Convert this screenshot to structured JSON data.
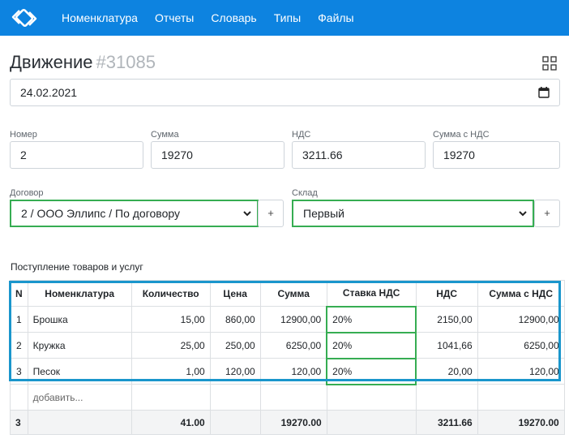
{
  "nav": {
    "items": [
      {
        "label": "Номенклатура"
      },
      {
        "label": "Отчеты"
      },
      {
        "label": "Словарь"
      },
      {
        "label": "Типы"
      },
      {
        "label": "Файлы"
      }
    ]
  },
  "page": {
    "title": "Движение",
    "doc_number": "#31085"
  },
  "date": {
    "value": "24.02.2021"
  },
  "fields": {
    "number": {
      "label": "Номер",
      "value": "2"
    },
    "sum": {
      "label": "Сумма",
      "value": "19270"
    },
    "vat": {
      "label": "НДС",
      "value": "3211.66"
    },
    "sum_vat": {
      "label": "Сумма с НДС",
      "value": "19270"
    }
  },
  "contract": {
    "label": "Договор",
    "value": "2 / ООО Эллипс / По договору",
    "add_label": "+"
  },
  "warehouse": {
    "label": "Склад",
    "value": "Первый",
    "add_label": "+"
  },
  "goods": {
    "title": "Поступление товаров и услуг",
    "headers": [
      "N",
      "Номенклатура",
      "Количество",
      "Цена",
      "Сумма",
      "Ставка НДС",
      "НДС",
      "Сумма с НДС"
    ],
    "rows": [
      [
        "1",
        "Брошка",
        "15,00",
        "860,00",
        "12900,00",
        "20%",
        "2150,00",
        "12900,00"
      ],
      [
        "2",
        "Кружка",
        "25,00",
        "250,00",
        "6250,00",
        "20%",
        "1041,66",
        "6250,00"
      ],
      [
        "3",
        "Песок",
        "1,00",
        "120,00",
        "120,00",
        "20%",
        "20,00",
        "120,00"
      ]
    ],
    "add_label": "добавить...",
    "footer": {
      "count": "3",
      "qty": "41.00",
      "sum": "19270.00",
      "vat": "3211.66",
      "sum_vat": "19270.00"
    }
  },
  "colors": {
    "navbar": "#0d83e0",
    "highlight_green": "#36ad52",
    "highlight_blue": "#1a96cc"
  },
  "icons": [
    "logo-icon",
    "grid-icon",
    "calendar-icon",
    "chevron-down-icon"
  ]
}
